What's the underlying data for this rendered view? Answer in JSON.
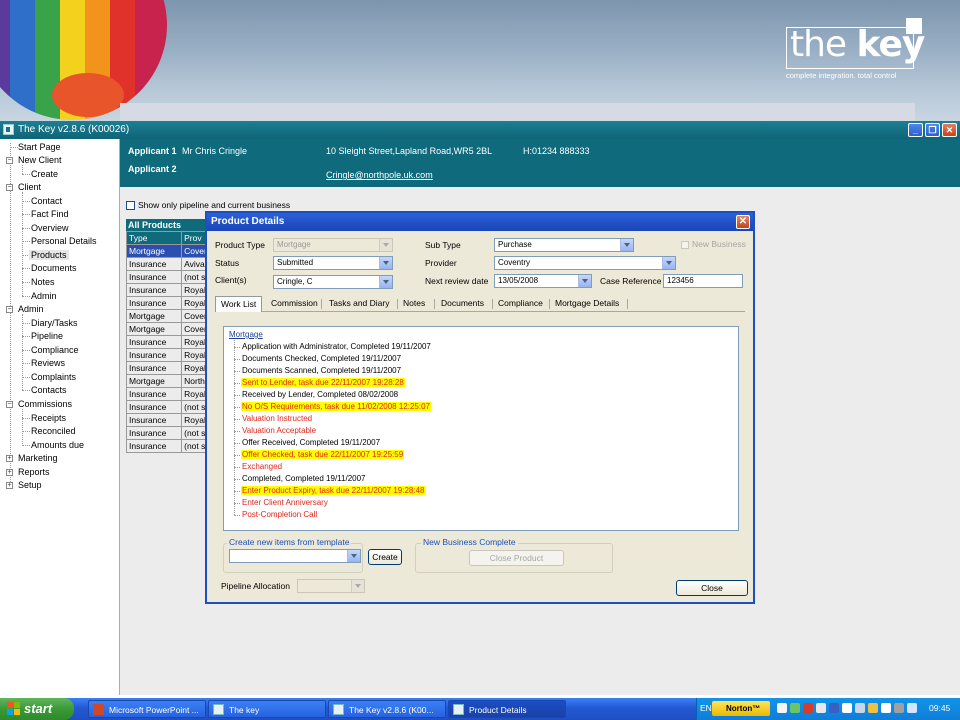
{
  "banner": {
    "logo_light": "the ",
    "logo_bold": "key",
    "tagline": "complete integration. total control"
  },
  "app": {
    "title": "The Key v2.8.6 (K00026)",
    "min": "_",
    "restore": "❐",
    "close": "✕"
  },
  "tree": {
    "start_page": "Start Page",
    "new_client": "New Client",
    "create": "Create",
    "client": "Client",
    "contact": "Contact",
    "fact_find": "Fact Find",
    "overview": "Overview",
    "personal_details": "Personal Details",
    "products": "Products",
    "documents": "Documents",
    "notes": "Notes",
    "admin": "Admin",
    "admin_root": "Admin",
    "diary_tasks": "Diary/Tasks",
    "pipeline": "Pipeline",
    "compliance": "Compliance",
    "reviews": "Reviews",
    "complaints": "Complaints",
    "contacts": "Contacts",
    "commissions": "Commissions",
    "receipts": "Receipts",
    "reconciled": "Reconciled",
    "amounts_due": "Amounts due",
    "marketing": "Marketing",
    "reports": "Reports",
    "setup": "Setup"
  },
  "applicant": {
    "label1": "Applicant 1",
    "name1": "Mr Chris Cringle",
    "address": "10 Sleight Street,Lapland Road,WR5 2BL",
    "phone": "H:01234 888333",
    "label2": "Applicant 2",
    "email": "Cringle@northpole.uk.com"
  },
  "filter": {
    "pipeline_only": "Show only pipeline and current business"
  },
  "all_products": {
    "title": "All Products",
    "headers": [
      "Type",
      "Prov"
    ],
    "rows": [
      [
        "Mortgage",
        "Cover"
      ],
      [
        "Insurance",
        "Aviva"
      ],
      [
        "Insurance",
        "(not s"
      ],
      [
        "Insurance",
        "Royal"
      ],
      [
        "Insurance",
        "Royal"
      ],
      [
        "Mortgage",
        "Cover"
      ],
      [
        "Mortgage",
        "Cover"
      ],
      [
        "Insurance",
        "Royal"
      ],
      [
        "Insurance",
        "Royal"
      ],
      [
        "Insurance",
        "Royal"
      ],
      [
        "Mortgage",
        "North"
      ],
      [
        "Insurance",
        "Royal"
      ],
      [
        "Insurance",
        "(not s"
      ],
      [
        "Insurance",
        "Royal"
      ],
      [
        "Insurance",
        "(not s"
      ],
      [
        "Insurance",
        "(not s"
      ]
    ]
  },
  "dialog": {
    "title": "Product Details",
    "close": "✕",
    "product_type_label": "Product Type",
    "product_type": "Mortgage",
    "status_label": "Status",
    "status": "Submitted",
    "clients_label": "Client(s)",
    "clients": "Cringle, C",
    "sub_type_label": "Sub Type",
    "sub_type": "Purchase",
    "provider_label": "Provider",
    "provider": "Coventry",
    "review_label": "Next review date",
    "review_date": "13/05/2008",
    "case_ref_label": "Case Reference",
    "case_ref": "123456",
    "new_business": "New Business",
    "tabs": [
      "Work List",
      "Commission",
      "Tasks and Diary",
      "Notes",
      "Documents",
      "Compliance",
      "Mortgage Details"
    ],
    "worklist_root": "Mortgage",
    "worklist": [
      "Application with Administrator, Completed 19/11/2007",
      "Documents Checked, Completed 19/11/2007",
      "Documents Scanned, Completed 19/11/2007",
      "Sent to Lender, task due 22/11/2007 19:28:28",
      "Received by Lender, Completed 08/02/2008",
      "No O/S Requirements, task due 11/02/2008 12:25:07",
      "Valuation Instructed",
      "Valuation Acceptable",
      "Offer Received, Completed 19/11/2007",
      "Offer Checked, task due 22/11/2007 19:25:59",
      "Exchanged",
      "Completed, Completed 19/11/2007",
      "Enter Product Expiry, task due 22/11/2007 19:28:48",
      "Enter Client Anniversary",
      "Post-Completion Call"
    ],
    "template_group": "Create new items from template",
    "create_btn": "Create",
    "nb_group": "New Business Complete",
    "close_product_btn": "Close Product",
    "pipeline_label": "Pipeline Allocation",
    "close_btn": "Close"
  },
  "taskbar": {
    "start": "start",
    "tasks": [
      "Microsoft PowerPoint ...",
      "The key",
      "The Key v2.8.6 (K00...",
      "Product Details"
    ],
    "lang": "EN",
    "norton": "Norton™",
    "time": "09:45"
  },
  "colors": {
    "teal": "#0f6a7b",
    "highlight": "#ffff00",
    "overdue_red": "#e1261c",
    "xp_blue": "#2459d4"
  }
}
